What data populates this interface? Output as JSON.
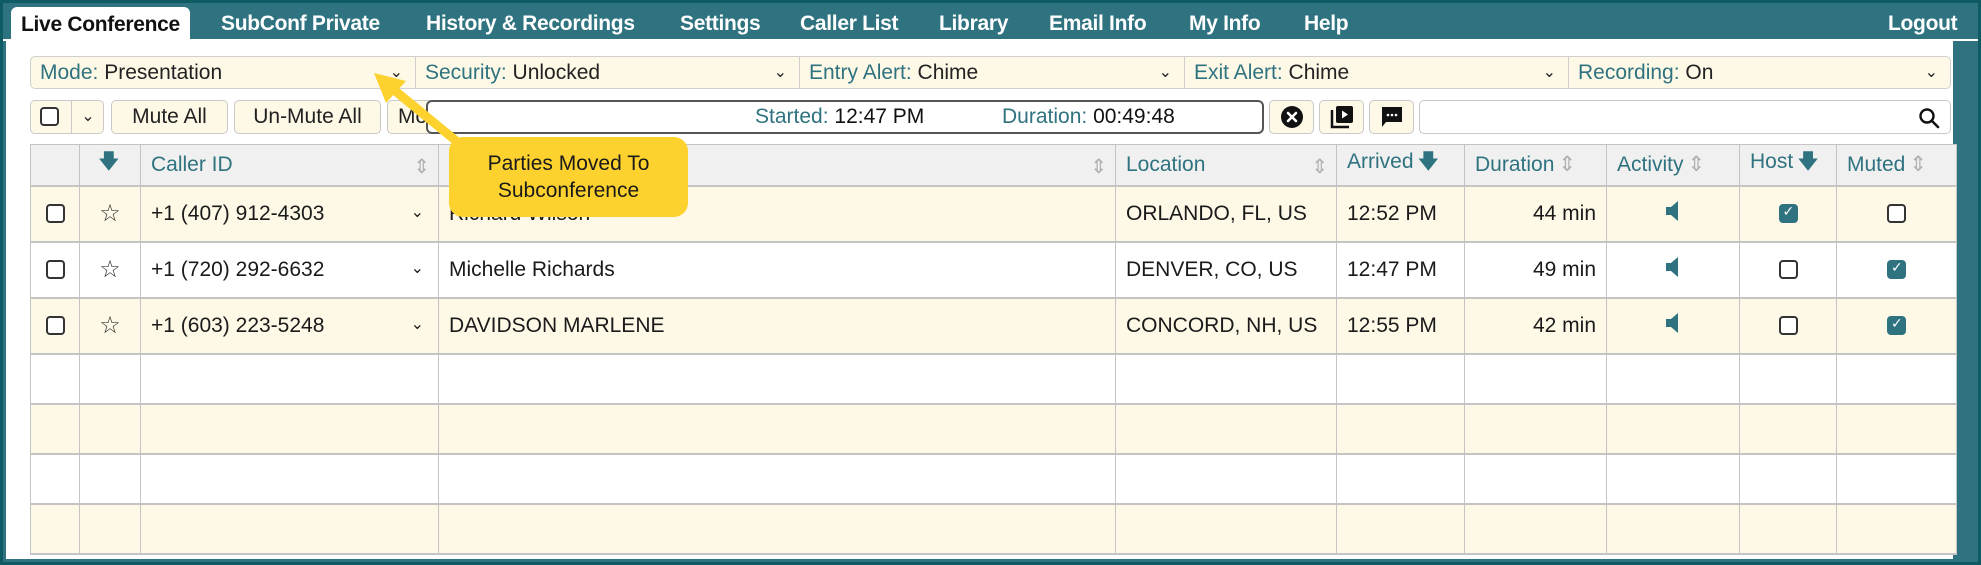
{
  "nav": {
    "tabs": [
      {
        "label": "Live Conference",
        "active": true
      },
      {
        "label": "SubConf Private",
        "active": false
      },
      {
        "label": "History & Recordings",
        "active": false
      },
      {
        "label": "Settings",
        "active": false
      },
      {
        "label": "Caller List",
        "active": false
      },
      {
        "label": "Library",
        "active": false
      },
      {
        "label": "Email Info",
        "active": false
      },
      {
        "label": "My Info",
        "active": false
      },
      {
        "label": "Help",
        "active": false
      }
    ],
    "logout": "Logout"
  },
  "dropdowns": [
    {
      "key": "Mode:",
      "value": "Presentation"
    },
    {
      "key": "Security:",
      "value": "Unlocked"
    },
    {
      "key": "Entry Alert:",
      "value": "Chime"
    },
    {
      "key": "Exit Alert:",
      "value": "Chime"
    },
    {
      "key": "Recording:",
      "value": "On"
    }
  ],
  "toolbar": {
    "mute_all": "Mute All",
    "unmute_all": "Un-Mute All",
    "more": "More",
    "started_label": "Started:",
    "started_value": "12:47 PM",
    "duration_label": "Duration:",
    "duration_value": "00:49:48",
    "search_placeholder": ""
  },
  "callout": {
    "line1": "Parties Moved To",
    "line2": "Subconference",
    "color": "#fdd22f"
  },
  "table": {
    "headers": {
      "caller_id": "Caller ID",
      "name": "",
      "location": "Location",
      "arrived": "Arrived",
      "duration": "Duration",
      "activity": "Activity",
      "host": "Host",
      "muted": "Muted"
    },
    "rows": [
      {
        "caller_id": "+1 (407) 912-4303",
        "name": "Richard Wilson",
        "location": "ORLANDO, FL, US",
        "arrived": "12:52 PM",
        "duration": "44 min",
        "host": true,
        "muted": false
      },
      {
        "caller_id": "+1 (720) 292-6632",
        "name": "Michelle Richards",
        "location": "DENVER, CO, US",
        "arrived": "12:47 PM",
        "duration": "49 min",
        "host": false,
        "muted": true
      },
      {
        "caller_id": "+1 (603) 223-5248",
        "name": "DAVIDSON MARLENE",
        "location": "CONCORD, NH, US",
        "arrived": "12:55 PM",
        "duration": "42 min",
        "host": false,
        "muted": true
      }
    ]
  },
  "colors": {
    "accent": "#2f7380",
    "row_tint": "#fdf9e6",
    "frame": "#0f5b63"
  }
}
